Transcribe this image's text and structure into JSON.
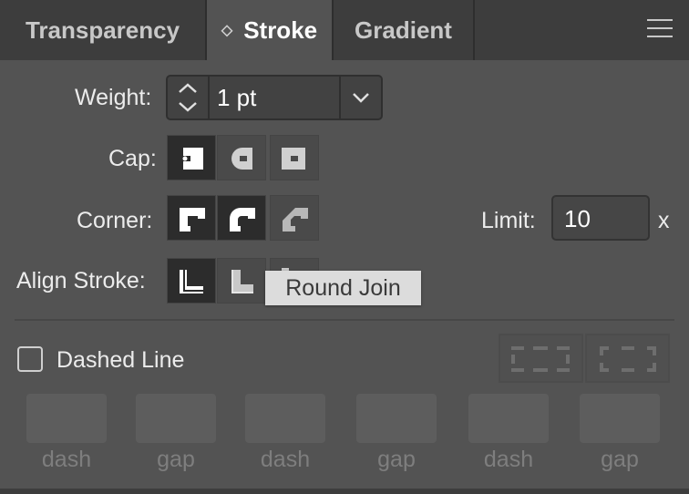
{
  "tabs": [
    {
      "label": "Transparency",
      "active": false
    },
    {
      "label": "Stroke",
      "active": true,
      "indicator": "◇"
    },
    {
      "label": "Gradient",
      "active": false
    }
  ],
  "panel_menu_icon": "hamburger-menu-icon",
  "weight": {
    "label": "Weight:",
    "value": "1 pt"
  },
  "cap": {
    "label": "Cap:",
    "options": [
      "butt-cap-icon",
      "round-cap-icon",
      "projecting-cap-icon"
    ],
    "selected": 0
  },
  "corner": {
    "label": "Corner:",
    "options": [
      "miter-join-icon",
      "round-join-icon",
      "bevel-join-icon"
    ],
    "selected": 0
  },
  "limit": {
    "label": "Limit:",
    "value": "10",
    "unit": "x"
  },
  "align_stroke": {
    "label": "Align Stroke:",
    "options": [
      "align-center-icon",
      "align-inside-icon",
      "align-outside-icon"
    ],
    "selected": 0
  },
  "tooltip": "Round Join",
  "dashed_line": {
    "label": "Dashed Line",
    "checked": false
  },
  "dash_fields": [
    "dash",
    "gap",
    "dash",
    "gap",
    "dash",
    "gap"
  ],
  "colors": {
    "panel": "#535353",
    "tabbar": "#3d3d3d",
    "selected_button": "#2c2c2c"
  }
}
